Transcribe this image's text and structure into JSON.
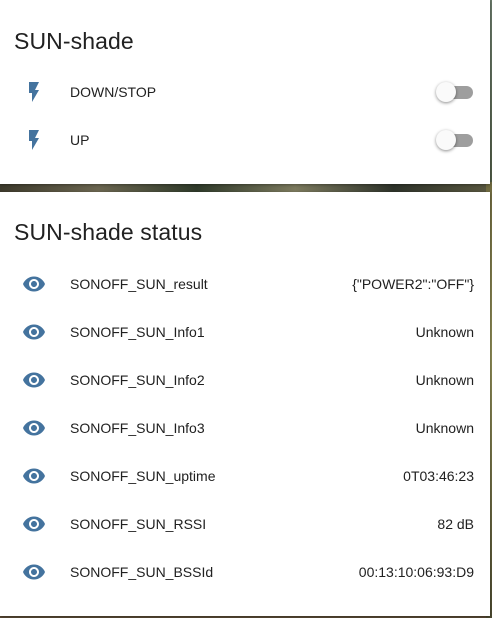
{
  "colors": {
    "icon": "#44739e",
    "text": "#212121",
    "card": "#ffffff",
    "toggle_track": "#9e9e9e"
  },
  "switch_card": {
    "title": "SUN-shade",
    "items": [
      {
        "icon": "flash-icon",
        "label": "DOWN/STOP",
        "state": "off"
      },
      {
        "icon": "flash-icon",
        "label": "UP",
        "state": "off"
      }
    ]
  },
  "status_card": {
    "title": "SUN-shade status",
    "items": [
      {
        "icon": "eye-icon",
        "label": "SONOFF_SUN_result",
        "value": "{\"POWER2\":\"OFF\"}"
      },
      {
        "icon": "eye-icon",
        "label": "SONOFF_SUN_Info1",
        "value": "Unknown"
      },
      {
        "icon": "eye-icon",
        "label": "SONOFF_SUN_Info2",
        "value": "Unknown"
      },
      {
        "icon": "eye-icon",
        "label": "SONOFF_SUN_Info3",
        "value": "Unknown"
      },
      {
        "icon": "eye-icon",
        "label": "SONOFF_SUN_uptime",
        "value": "0T03:46:23"
      },
      {
        "icon": "eye-icon",
        "label": "SONOFF_SUN_RSSI",
        "value": "82 dB"
      },
      {
        "icon": "eye-icon",
        "label": "SONOFF_SUN_BSSId",
        "value": "00:13:10:06:93:D9"
      }
    ]
  }
}
